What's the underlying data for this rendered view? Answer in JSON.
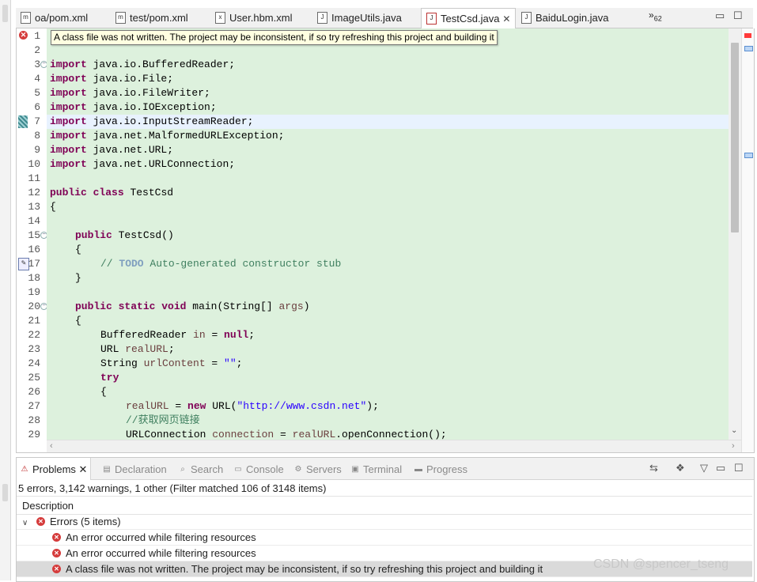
{
  "editor_tabs": [
    {
      "label": "oa/pom.xml",
      "icon": "maven-file-icon",
      "active": false
    },
    {
      "label": "test/pom.xml",
      "icon": "maven-file-icon",
      "active": false
    },
    {
      "label": "User.hbm.xml",
      "icon": "xml-file-icon",
      "active": false
    },
    {
      "label": "ImageUtils.java",
      "icon": "java-file-icon",
      "active": false
    },
    {
      "label": "TestCsd.java",
      "icon": "java-error-file-icon",
      "active": true
    },
    {
      "label": "BaiduLogin.java",
      "icon": "java-file-icon",
      "active": false
    }
  ],
  "overflow": {
    "chevron": "»",
    "count": "62"
  },
  "tooltip": "A class file was not written. The project may be inconsistent, if so try refreshing this project and building it",
  "line_numbers": [
    "1",
    "2",
    "3",
    "4",
    "5",
    "6",
    "7",
    "8",
    "9",
    "10",
    "11",
    "12",
    "13",
    "14",
    "15",
    "16",
    "17",
    "18",
    "19",
    "20",
    "21",
    "22",
    "23",
    "24",
    "25",
    "26",
    "27",
    "28",
    "29"
  ],
  "code": {
    "l3": {
      "kw": "import",
      "rest": " java.io.BufferedReader;"
    },
    "l4": {
      "kw": "import",
      "rest": " java.io.File;"
    },
    "l5": {
      "kw": "import",
      "rest": " java.io.FileWriter;"
    },
    "l6": {
      "kw": "import",
      "rest": " java.io.IOException;"
    },
    "l7": {
      "kw": "import",
      "rest": " java.io.InputStreamReader;"
    },
    "l8": {
      "kw": "import",
      "rest": " java.net.MalformedURLException;"
    },
    "l9": {
      "kw": "import",
      "rest": " java.net.URL;"
    },
    "l10": {
      "kw": "import",
      "rest": " java.net.URLConnection;"
    },
    "l12": {
      "kw1": "public",
      "kw2": "class",
      "rest": " TestCsd"
    },
    "l13": "{",
    "l15": {
      "kw": "public",
      "rest": " TestCsd()"
    },
    "l16": "{",
    "l17": {
      "slash": "// ",
      "todo": "TODO",
      "rest": " Auto-generated constructor stub"
    },
    "l18": "}",
    "l20": {
      "kw1": "public",
      "kw2": "static",
      "kw3": "void",
      "rest": " main(String[] ",
      "var": "args",
      "end": ")"
    },
    "l21": "{",
    "l22": {
      "pre": "BufferedReader ",
      "var": "in",
      "mid": " = ",
      "kw": "null",
      "end": ";"
    },
    "l23": {
      "pre": "URL ",
      "var": "realURL",
      "end": ";"
    },
    "l24": {
      "pre": "String ",
      "var": "urlContent",
      "mid": " = ",
      "str": "\"\"",
      "end": ";"
    },
    "l25": "try",
    "l26": "{",
    "l27": {
      "var": "realURL",
      "mid": " = ",
      "kw": "new",
      "pre": " URL(",
      "str": "\"http://www.csdn.net\"",
      "end": ");"
    },
    "l28": "//获取网页链接",
    "l29": {
      "pre": "URLConnection ",
      "var": "connection",
      "mid": " = ",
      "var2": "realURL",
      "end": ".openConnection();"
    }
  },
  "problems": {
    "tabs": [
      {
        "label": "Problems",
        "icon": "problems-icon",
        "active": true
      },
      {
        "label": "Declaration",
        "icon": "declaration-icon",
        "active": false
      },
      {
        "label": "Search",
        "icon": "search-icon",
        "active": false
      },
      {
        "label": "Console",
        "icon": "console-icon",
        "active": false
      },
      {
        "label": "Servers",
        "icon": "servers-icon",
        "active": false
      },
      {
        "label": "Terminal",
        "icon": "terminal-icon",
        "active": false
      },
      {
        "label": "Progress",
        "icon": "progress-icon",
        "active": false
      }
    ],
    "summary": "5 errors, 3,142 warnings, 1 other (Filter matched 106 of 3148 items)",
    "column_header": "Description",
    "group_label": "Errors (5 items)",
    "rows": [
      "An error occurred while filtering resources",
      "An error occurred while filtering resources",
      "A class file was not written. The project may be inconsistent, if so try refreshing this project and building it"
    ]
  },
  "watermark": "CSDN @spencer_tseng"
}
